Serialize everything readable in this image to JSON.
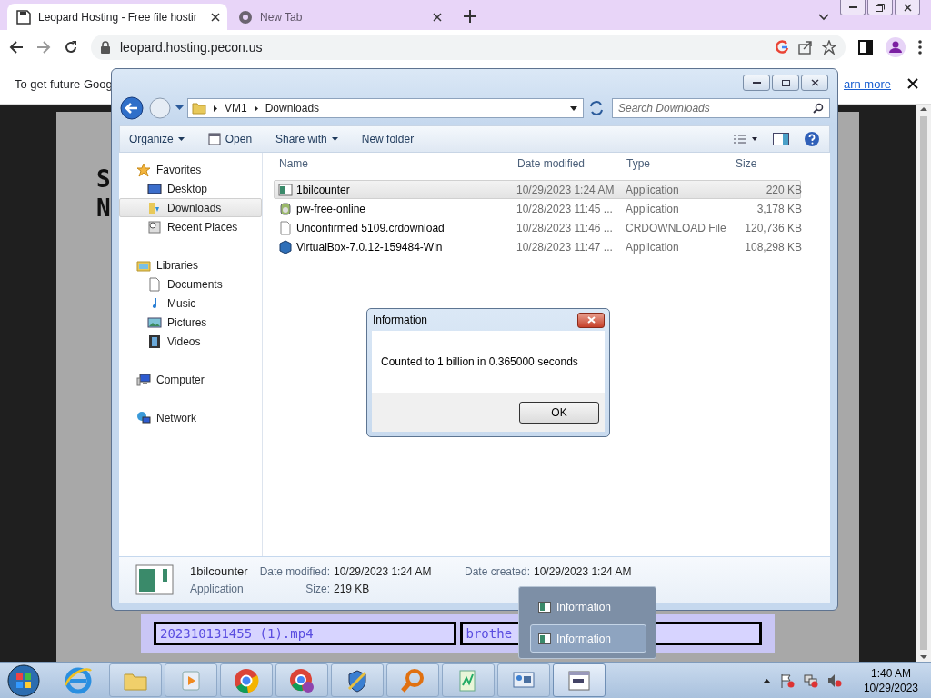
{
  "browser": {
    "tabs": [
      {
        "title": "Leopard Hosting - Free file hostir",
        "selected": true
      },
      {
        "title": "New Tab",
        "selected": false
      }
    ],
    "url": "leopard.hosting.pecon.us",
    "infobar": {
      "text": "To get future Goog",
      "link": "arn more"
    }
  },
  "page": {
    "letters": [
      "S",
      "N"
    ],
    "files": [
      "202310131455 (1).mp4",
      "brothe"
    ]
  },
  "explorer": {
    "breadcrumb": [
      "VM1",
      "Downloads"
    ],
    "search_placeholder": "Search Downloads",
    "toolbar": [
      {
        "label": "Organize",
        "kind": "menu"
      },
      {
        "label": "Open",
        "kind": "icon"
      },
      {
        "label": "Share with",
        "kind": "menu"
      },
      {
        "label": "New folder",
        "kind": "plain"
      }
    ],
    "nav": [
      {
        "label": "Favorites",
        "children": [
          {
            "label": "Desktop",
            "selected": false
          },
          {
            "label": "Downloads",
            "selected": true
          },
          {
            "label": "Recent Places",
            "selected": false
          }
        ]
      },
      {
        "label": "Libraries",
        "children": [
          {
            "label": "Documents",
            "selected": false
          },
          {
            "label": "Music",
            "selected": false
          },
          {
            "label": "Pictures",
            "selected": false
          },
          {
            "label": "Videos",
            "selected": false
          }
        ]
      },
      {
        "label": "Computer"
      },
      {
        "label": "Network"
      }
    ],
    "columns": [
      "Name",
      "Date modified",
      "Type",
      "Size"
    ],
    "rows": [
      {
        "name": "1bilcounter",
        "date": "10/29/2023 1:24 AM",
        "type": "Application",
        "size": "220 KB",
        "selected": true
      },
      {
        "name": "pw-free-online",
        "date": "10/28/2023 11:45 ...",
        "type": "Application",
        "size": "3,178 KB",
        "selected": false
      },
      {
        "name": "Unconfirmed 5109.crdownload",
        "date": "10/28/2023 11:46 ...",
        "type": "CRDOWNLOAD File",
        "size": "120,736 KB",
        "selected": false
      },
      {
        "name": "VirtualBox-7.0.12-159484-Win",
        "date": "10/28/2023 11:47 ...",
        "type": "Application",
        "size": "108,298 KB",
        "selected": false
      }
    ],
    "details": {
      "name": "1bilcounter",
      "type": "Application",
      "modified_label": "Date modified:",
      "modified": "10/29/2023 1:24 AM",
      "created_label": "Date created:",
      "created": "10/29/2023 1:24 AM",
      "size_label": "Size:",
      "size": "219 KB"
    }
  },
  "dialog": {
    "title": "Information",
    "message": "Counted to 1 billion in 0.365000 seconds",
    "button": "OK"
  },
  "taskbar": {
    "buttons": [
      {
        "selected": false
      },
      {
        "selected": false
      },
      {
        "selected": false
      },
      {
        "selected": false
      },
      {
        "selected": false
      },
      {
        "selected": false
      },
      {
        "selected": false
      },
      {
        "selected": false
      },
      {
        "selected": true
      }
    ],
    "popup": [
      {
        "label": "Information",
        "selected": false
      },
      {
        "label": "Information",
        "selected": true
      }
    ],
    "time": "1:40 AM",
    "date": "10/29/2023"
  }
}
